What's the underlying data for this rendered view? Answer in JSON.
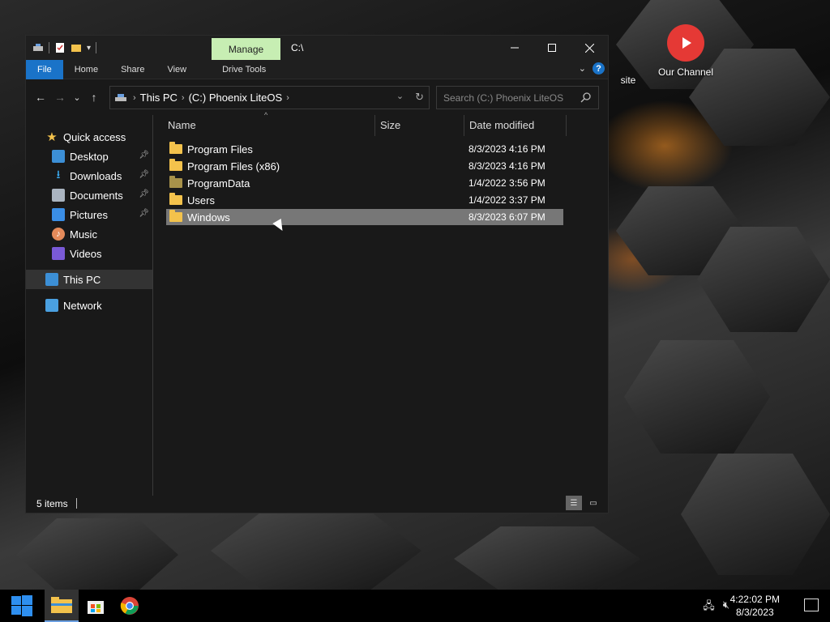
{
  "window": {
    "title": "C:\\",
    "manage_tab": "Manage",
    "ribbon_tabs": [
      "File",
      "Home",
      "Share",
      "View",
      "Drive Tools"
    ]
  },
  "address": {
    "crumbs": [
      "This PC",
      "(C:) Phoenix LiteOS"
    ]
  },
  "search": {
    "placeholder": "Search (C:) Phoenix LiteOS"
  },
  "nav_pane": {
    "quick_access": "Quick access",
    "items": [
      {
        "label": "Desktop",
        "pinned": true
      },
      {
        "label": "Downloads",
        "pinned": true
      },
      {
        "label": "Documents",
        "pinned": true
      },
      {
        "label": "Pictures",
        "pinned": true
      },
      {
        "label": "Music",
        "pinned": false
      },
      {
        "label": "Videos",
        "pinned": false
      }
    ],
    "this_pc": "This PC",
    "network": "Network"
  },
  "columns": {
    "name": "Name",
    "size": "Size",
    "date": "Date modified"
  },
  "files": [
    {
      "name": "Program Files",
      "date": "8/3/2023 4:16 PM"
    },
    {
      "name": "Program Files (x86)",
      "date": "8/3/2023 4:16 PM"
    },
    {
      "name": "ProgramData",
      "date": "1/4/2022 3:56 PM"
    },
    {
      "name": "Users",
      "date": "1/4/2022 3:37 PM"
    },
    {
      "name": "Windows",
      "date": "8/3/2023 6:07 PM"
    }
  ],
  "status": {
    "items": "5 items"
  },
  "desktop": {
    "icons": [
      "site",
      "Our Channel"
    ]
  },
  "taskbar": {
    "time": "4:22:02 PM",
    "date": "8/3/2023"
  },
  "colors": {
    "accent": "#1a73c8",
    "manage_tab": "#c7eeb3",
    "folder": "#f3c24c",
    "selection": "#777777"
  }
}
